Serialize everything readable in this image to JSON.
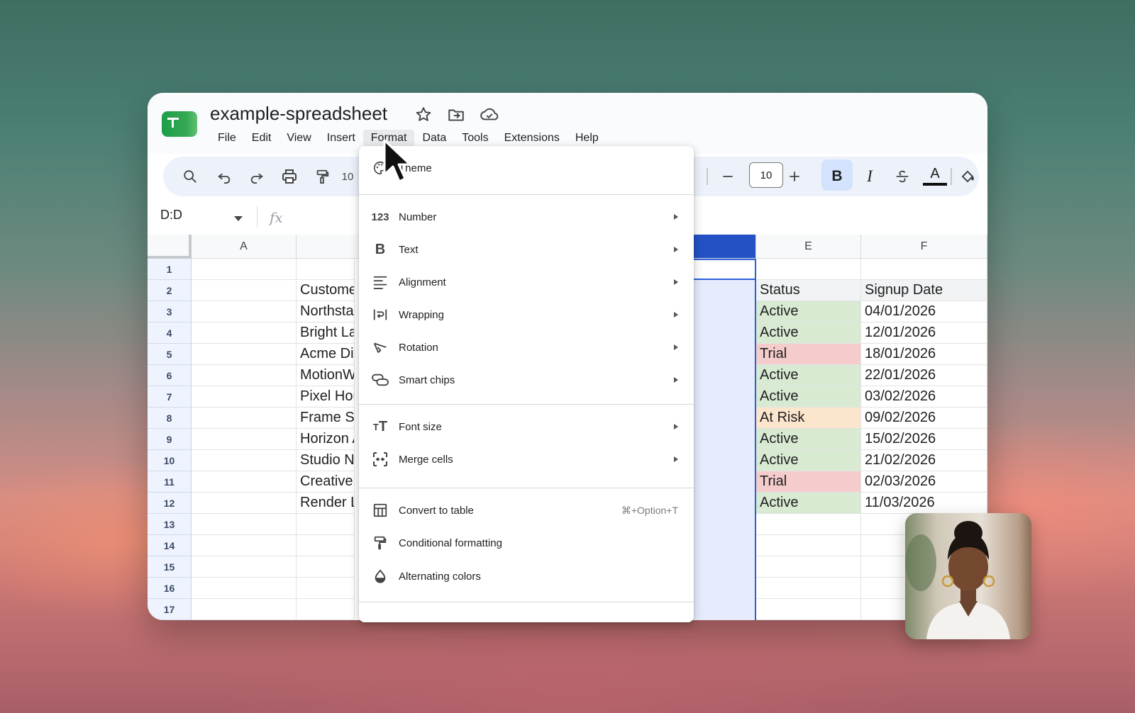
{
  "app": {
    "title": "example-spreadsheet",
    "menus": [
      {
        "label": "File"
      },
      {
        "label": "Edit"
      },
      {
        "label": "View"
      },
      {
        "label": "Insert"
      },
      {
        "label": "Format"
      },
      {
        "label": "Data"
      },
      {
        "label": "Tools"
      },
      {
        "label": "Extensions"
      },
      {
        "label": "Help"
      }
    ]
  },
  "toolbar": {
    "zoom_partial": "10",
    "font_size": "10",
    "bold_label": "B",
    "italic_label": "I",
    "text_color_label": "A"
  },
  "formula_bar": {
    "name_box": "D:D",
    "fx_label": "fx"
  },
  "grid": {
    "columns": [
      "A",
      "",
      "",
      "E",
      "F"
    ],
    "rows": [
      "1",
      "2",
      "3",
      "4",
      "5",
      "6",
      "7",
      "8",
      "9",
      "10",
      "11",
      "12",
      "13",
      "14",
      "15",
      "16",
      "17"
    ],
    "col_b": [
      "",
      "Custome",
      "Northstar",
      "Bright La",
      "Acme Dig",
      "MotionWo",
      "Pixel Hou",
      "Frame St",
      "Horizon A",
      "Studio No",
      "Creative",
      "Render L"
    ],
    "status": [
      "",
      "Status",
      "Active",
      "Active",
      "Trial",
      "Active",
      "Active",
      "At Risk",
      "Active",
      "Active",
      "Trial",
      "Active"
    ],
    "signup": [
      "",
      "Signup Date",
      "04/01/2026",
      "12/01/2026",
      "18/01/2026",
      "22/01/2026",
      "03/02/2026",
      "09/02/2026",
      "15/02/2026",
      "21/02/2026",
      "02/03/2026",
      "11/03/2026"
    ],
    "status_colors": {
      "Active": "#d9ead3",
      "Trial": "#f4cccc",
      "At Risk": "#fce5cd"
    }
  },
  "format_menu": {
    "theme_label": "Theme",
    "items": [
      {
        "label": "Number",
        "icon": "number-icon"
      },
      {
        "label": "Text",
        "icon": "bold-icon"
      },
      {
        "label": "Alignment",
        "icon": "align-icon"
      },
      {
        "label": "Wrapping",
        "icon": "wrap-icon"
      },
      {
        "label": "Rotation",
        "icon": "rotation-icon"
      },
      {
        "label": "Smart chips",
        "icon": "chips-icon"
      },
      {
        "label": "Font size",
        "icon": "font-size-icon"
      },
      {
        "label": "Merge cells",
        "icon": "merge-icon"
      },
      {
        "label": "Convert to table",
        "icon": "table-icon",
        "shortcut": "⌘+Option+T"
      },
      {
        "label": "Conditional formatting",
        "icon": "paint-roller-icon"
      },
      {
        "label": "Alternating colors",
        "icon": "drop-icon"
      }
    ]
  },
  "colors": {
    "selection": "#2452c4",
    "row_header": "#eef3fd",
    "toolbar_bg": "#edf2fa",
    "bold_active": "#d3e3fd"
  }
}
